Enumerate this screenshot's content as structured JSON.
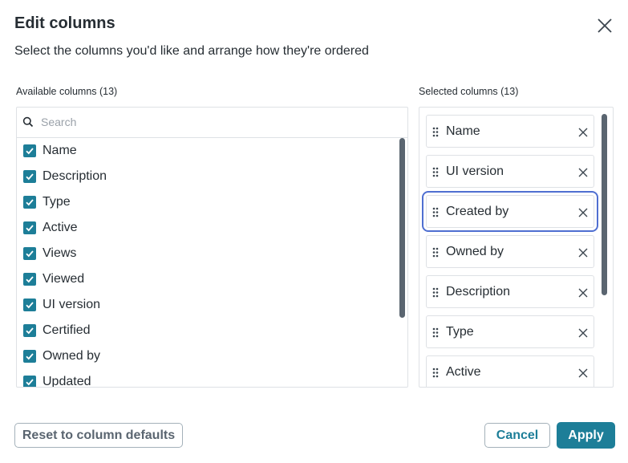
{
  "dialog": {
    "title": "Edit columns",
    "subtitle": "Select the columns you'd like and arrange how they're ordered"
  },
  "available": {
    "label": "Available columns (13)",
    "search_placeholder": "Search",
    "items": [
      {
        "label": "Name",
        "checked": true
      },
      {
        "label": "Description",
        "checked": true
      },
      {
        "label": "Type",
        "checked": true
      },
      {
        "label": "Active",
        "checked": true
      },
      {
        "label": "Views",
        "checked": true
      },
      {
        "label": "Viewed",
        "checked": true
      },
      {
        "label": "UI version",
        "checked": true
      },
      {
        "label": "Certified",
        "checked": true
      },
      {
        "label": "Owned by",
        "checked": true
      },
      {
        "label": "Updated",
        "checked": true
      }
    ]
  },
  "selected": {
    "label": "Selected columns (13)",
    "items": [
      {
        "label": "Name"
      },
      {
        "label": "UI version"
      },
      {
        "label": "Created by",
        "focused": true
      },
      {
        "label": "Owned by"
      },
      {
        "label": "Description"
      },
      {
        "label": "Type"
      },
      {
        "label": "Active"
      }
    ]
  },
  "buttons": {
    "reset": "Reset to column defaults",
    "cancel": "Cancel",
    "apply": "Apply"
  },
  "colors": {
    "accent": "#1d7e98",
    "focus": "#4f6fd1",
    "text": "#262d33",
    "border": "#dee1e5"
  }
}
